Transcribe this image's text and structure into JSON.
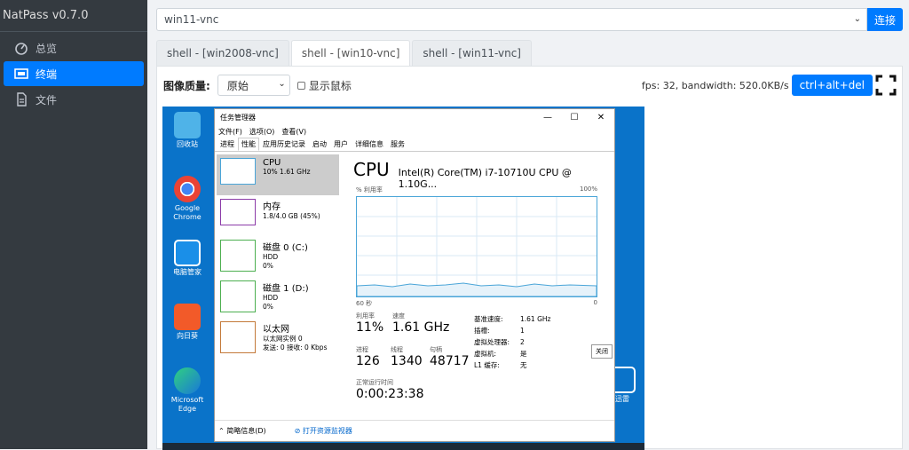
{
  "app": {
    "title": "NatPass v0.7.0"
  },
  "sidebar": {
    "items": [
      {
        "label": "总览",
        "icon": "dashboard-icon"
      },
      {
        "label": "终端",
        "icon": "terminal-icon",
        "active": true
      },
      {
        "label": "文件",
        "icon": "file-icon"
      }
    ]
  },
  "topbar": {
    "connection_value": "win11-vnc",
    "connect_label": "连接"
  },
  "tabs": [
    {
      "label": "shell - [win2008-vnc]"
    },
    {
      "label": "shell - [win10-vnc]",
      "active": true
    },
    {
      "label": "shell - [win11-vnc]"
    }
  ],
  "toolbar": {
    "quality_label": "图像质量:",
    "quality_value": "原始",
    "show_cursor_label": "显示鼠标",
    "fps_text": "fps: 32, bandwidth: 520.0KB/s",
    "cad_label": "ctrl+alt+del"
  },
  "remote": {
    "desktop_icons": [
      {
        "label": "回收站"
      },
      {
        "label": "Google Chrome"
      },
      {
        "label": "电脑管家"
      },
      {
        "label": "向日葵"
      },
      {
        "label": "Microsoft Edge"
      },
      {
        "label": "迅雷"
      }
    ],
    "task_manager": {
      "title": "任务管理器",
      "menu": [
        "文件(F)",
        "选项(O)",
        "查看(V)"
      ],
      "tabs": [
        "进程",
        "性能",
        "应用历史记录",
        "启动",
        "用户",
        "详细信息",
        "服务"
      ],
      "resources": [
        {
          "title": "CPU",
          "lines": [
            "10% 1.61 GHz"
          ]
        },
        {
          "title": "内存",
          "lines": [
            "1.8/4.0 GB (45%)"
          ]
        },
        {
          "title": "磁盘 0 (C:)",
          "lines": [
            "HDD",
            "0%"
          ]
        },
        {
          "title": "磁盘 1 (D:)",
          "lines": [
            "HDD",
            "0%"
          ]
        },
        {
          "title": "以太网",
          "lines": [
            "以太网实例 0",
            "发送: 0 接收: 0 Kbps"
          ]
        }
      ],
      "cpu_title": "CPU",
      "cpu_name": "Intel(R) Core(TM) i7-10710U CPU @ 1.10G...",
      "graph_label_left": "% 利用率",
      "graph_label_right": "100%",
      "graph_x_left": "60 秒",
      "graph_x_right": "0",
      "utilization_label": "利用率",
      "utilization_value": "11%",
      "speed_label": "速度",
      "speed_value": "1.61 GHz",
      "processes_label": "进程",
      "processes_value": "126",
      "threads_label": "线程",
      "threads_value": "1340",
      "handles_label": "句柄",
      "handles_value": "48717",
      "uptime_label": "正常运行时间",
      "uptime_value": "0:00:23:38",
      "details": [
        {
          "k": "基准速度:",
          "v": "1.61 GHz"
        },
        {
          "k": "插槽:",
          "v": "1"
        },
        {
          "k": "虚拟处理器:",
          "v": "2"
        },
        {
          "k": "虚拟机:",
          "v": "是"
        },
        {
          "k": "L1 缓存:",
          "v": "无"
        }
      ],
      "close_label": "关闭",
      "footer_less": "简略信息(D)",
      "footer_monitor": "打开资源监视器"
    }
  }
}
